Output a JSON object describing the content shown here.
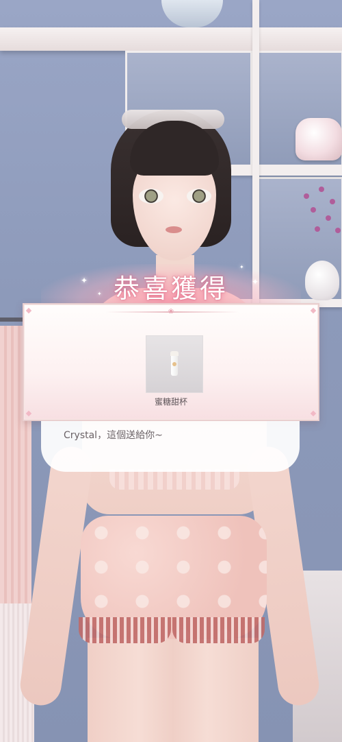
{
  "reward": {
    "title": "恭喜獲得",
    "item_name": "蜜糖甜杯",
    "item_icon": "cup-icon"
  },
  "dialogue": {
    "text": "Crystal，這個送給你~"
  },
  "colors": {
    "title_glow": "#f596aa",
    "panel_border": "#e9cfcf",
    "panel_bg": "#fdf1f1",
    "text": "#5d5458"
  }
}
